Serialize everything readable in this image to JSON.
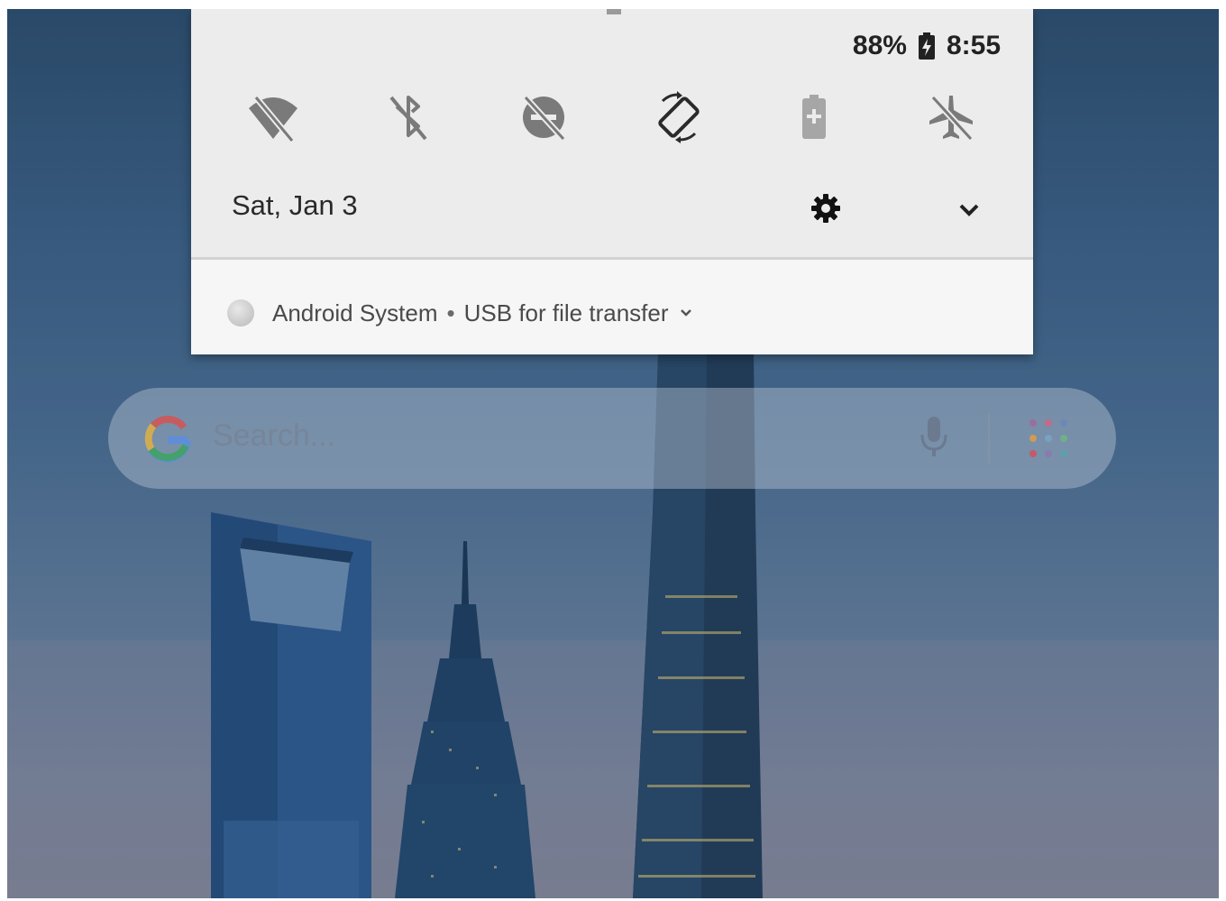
{
  "status": {
    "battery_percent": "88%",
    "time": "8:55",
    "battery_icon": "battery-charging-icon"
  },
  "quick_settings": {
    "tiles": [
      {
        "name": "wifi-off-icon",
        "label": "Wi-Fi"
      },
      {
        "name": "bluetooth-off-icon",
        "label": "Bluetooth"
      },
      {
        "name": "do-not-disturb-off-icon",
        "label": "Do not disturb"
      },
      {
        "name": "auto-rotate-icon",
        "label": "Auto-rotate"
      },
      {
        "name": "battery-saver-icon",
        "label": "Battery saver"
      },
      {
        "name": "airplane-mode-off-icon",
        "label": "Airplane mode"
      }
    ],
    "date": "Sat, Jan 3",
    "settings_icon": "gear-icon",
    "expand_icon": "chevron-down-icon"
  },
  "notification": {
    "app_name": "Android System",
    "separator": "•",
    "title": "USB for file transfer",
    "expand_icon": "chevron-down-icon"
  },
  "search": {
    "placeholder": "Search...",
    "logo": "google-g-icon",
    "mic_icon": "microphone-icon",
    "apps_icon": "app-drawer-icon"
  },
  "colors": {
    "shade_bg": "#ececec",
    "notification_bg": "#f6f6f6",
    "icon_gray": "#7a7a7a",
    "icon_active": "#2a2a2a"
  }
}
